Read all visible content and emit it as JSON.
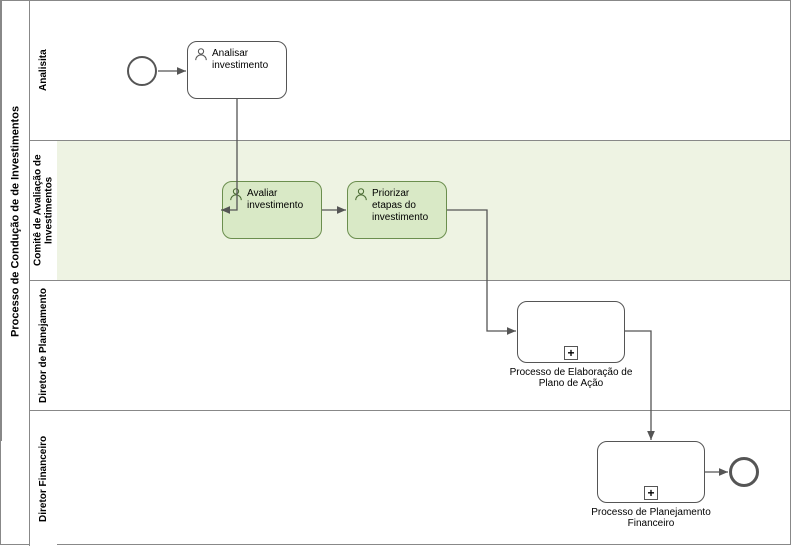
{
  "chart_data": {
    "type": "bpmn",
    "pool": "Processo de Condução de de Investimentos",
    "lanes": [
      {
        "id": "lane1",
        "name": "Analisita"
      },
      {
        "id": "lane2",
        "name": "Comitê de Avaliação de Investimentos"
      },
      {
        "id": "lane3",
        "name": "Diretor de Planejamento"
      },
      {
        "id": "lane4",
        "name": "Diretor Financeiro"
      }
    ],
    "nodes": [
      {
        "id": "start",
        "type": "startEvent",
        "lane": "lane1"
      },
      {
        "id": "t1",
        "type": "userTask",
        "lane": "lane1",
        "label": "Analisar investimento",
        "highlight": false
      },
      {
        "id": "t2",
        "type": "userTask",
        "lane": "lane2",
        "label": "Avaliar investimento",
        "highlight": true
      },
      {
        "id": "t3",
        "type": "userTask",
        "lane": "lane2",
        "label": "Priorizar etapas do investimento",
        "highlight": true
      },
      {
        "id": "sp1",
        "type": "subprocess",
        "lane": "lane3",
        "label": "Processo de Elaboração de Plano de Ação"
      },
      {
        "id": "sp2",
        "type": "subprocess",
        "lane": "lane4",
        "label": "Processo de Planejamento Financeiro"
      },
      {
        "id": "end",
        "type": "endEvent",
        "lane": "lane4"
      }
    ],
    "flows": [
      {
        "from": "start",
        "to": "t1"
      },
      {
        "from": "t1",
        "to": "t2"
      },
      {
        "from": "t2",
        "to": "t3"
      },
      {
        "from": "t3",
        "to": "sp1"
      },
      {
        "from": "sp1",
        "to": "sp2"
      },
      {
        "from": "sp2",
        "to": "end"
      }
    ]
  },
  "pool_label": "Processo de Condução de de Investimentos",
  "lanes": {
    "lane1": "Analisita",
    "lane2": "Comitê de Avaliação de Investimentos",
    "lane3": "Diretor de Planejamento",
    "lane4": "Diretor Financeiro"
  },
  "tasks": {
    "t1": "Analisar investimento",
    "t2": "Avaliar investimento",
    "t3": "Priorizar etapas do investimento"
  },
  "subprocesses": {
    "sp1": "Processo de Elaboração de Plano de Ação",
    "sp2": "Processo de Planejamento Financeiro"
  },
  "markers": {
    "plus": "+"
  }
}
